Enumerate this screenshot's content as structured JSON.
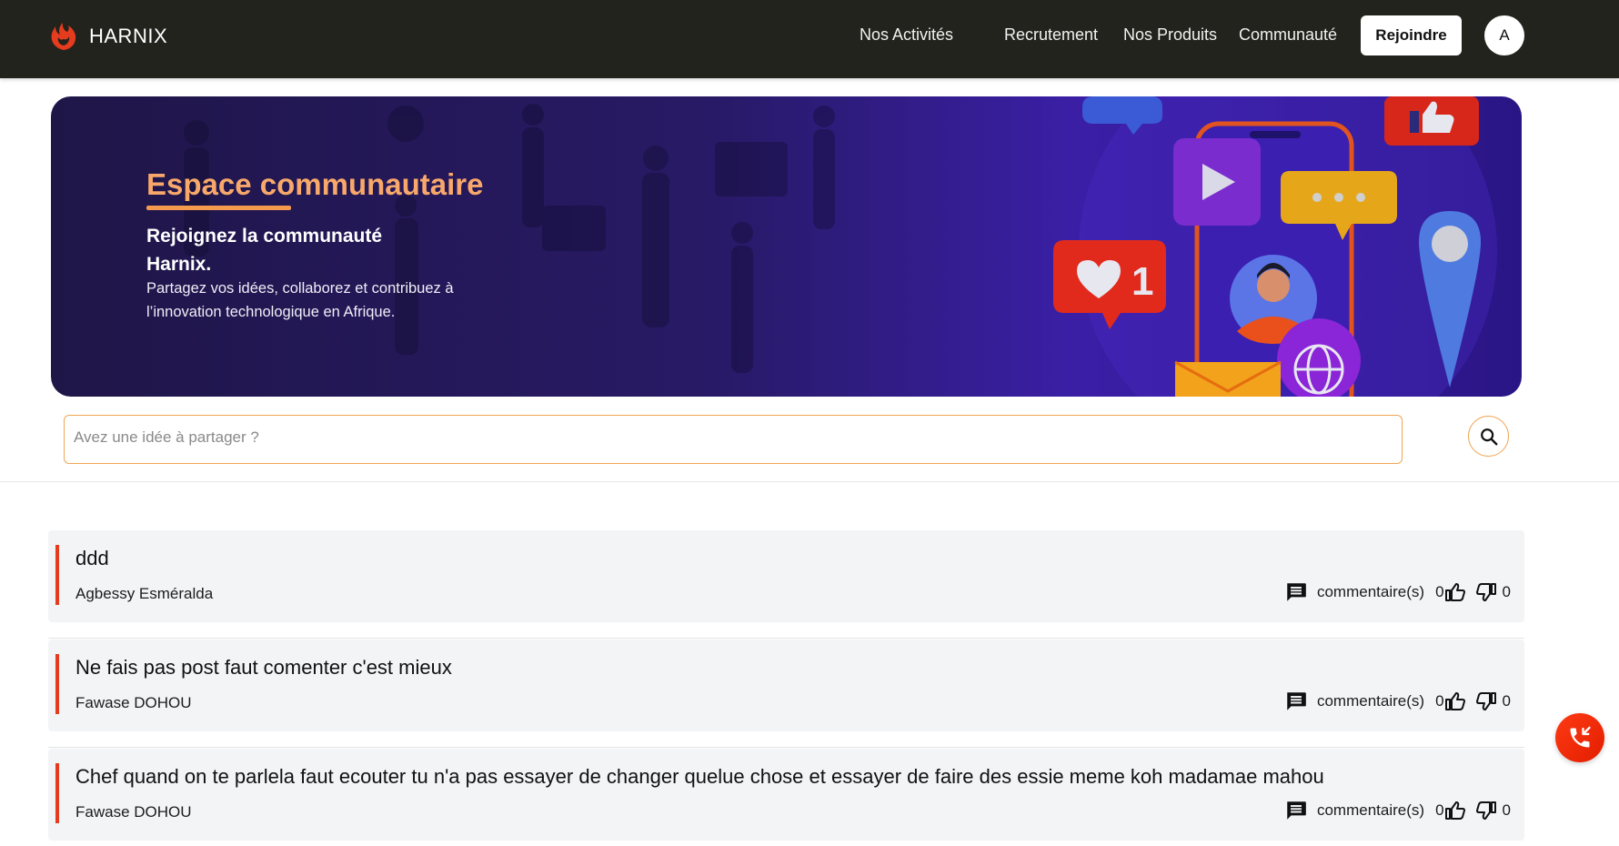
{
  "brand": {
    "name": "HARNIX",
    "logo_icon": "phoenix-logo-icon",
    "accent": "#e53b1e"
  },
  "nav": {
    "items": [
      {
        "label": "Nos Activités"
      },
      {
        "label": "Recrutement"
      },
      {
        "label": "Nos Produits"
      },
      {
        "label": "Communauté"
      }
    ],
    "join_label": "Rejoindre",
    "avatar_initial": "A"
  },
  "hero": {
    "title": "Espace communautaire",
    "subtitle": "Rejoignez la communauté Harnix.",
    "description": "Partagez vos idées, collaborez et contribuez à l’innovation technologique en Afrique.",
    "like_count_badge": "1"
  },
  "search": {
    "placeholder": "Avez une idée à partager ?",
    "icon": "search-icon"
  },
  "posts": [
    {
      "title": "ddd",
      "author": "Agbessy Esméralda",
      "comments_label": "commentaire(s)",
      "likes": "0",
      "dislikes": "0"
    },
    {
      "title": "Ne fais pas post faut comenter c'est mieux",
      "author": "Fawase DOHOU",
      "comments_label": "commentaire(s)",
      "likes": "0",
      "dislikes": "0"
    },
    {
      "title": "Chef quand on te parlela faut ecouter tu n'a pas essayer de changer quelue chose et essayer de faire des essie meme koh madamae mahou",
      "author": "Fawase DOHOU",
      "comments_label": "commentaire(s)",
      "likes": "0",
      "dislikes": "0"
    }
  ],
  "colors": {
    "navbar": "#22231c",
    "accent_orange": "#f39a4f",
    "post_bar": "#e53b1e",
    "fab": "#ff3b14"
  }
}
